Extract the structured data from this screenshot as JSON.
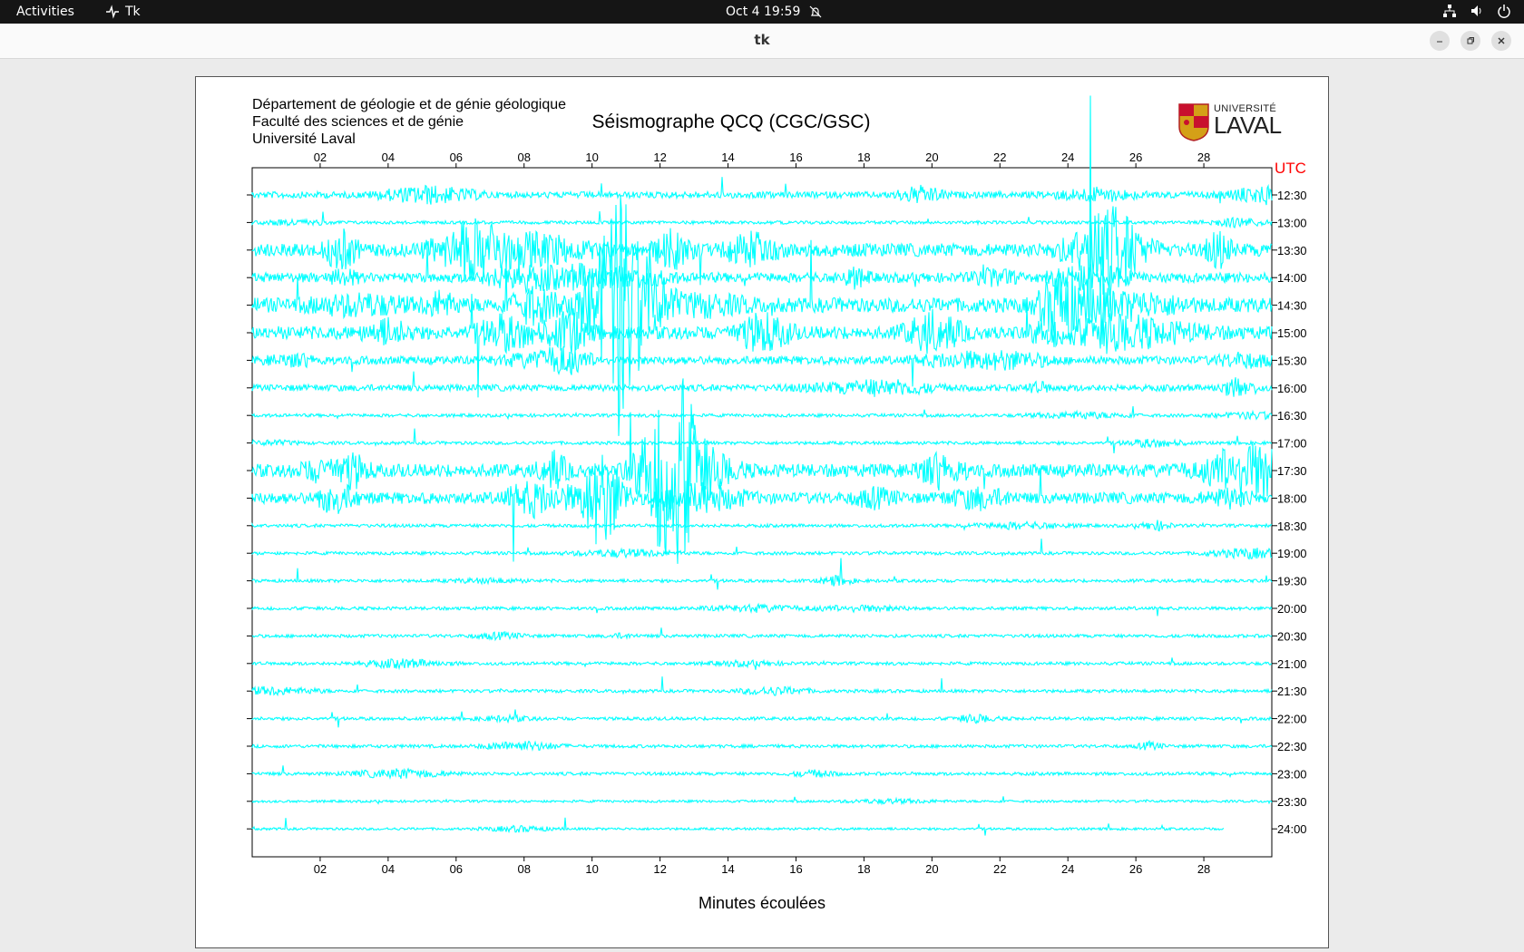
{
  "topbar": {
    "activities": "Activities",
    "app_name": "Tk",
    "clock": "Oct 4  19:59"
  },
  "window": {
    "title": "tk"
  },
  "plot": {
    "header_lines": [
      "Département de géologie et de génie géologique",
      "Faculté des sciences et de génie",
      "Université Laval"
    ],
    "title": "Séismographe QCQ (CGC/GSC)",
    "logo_top": "UNIVERSITÉ",
    "logo_main": "LAVAL",
    "utc_label": "UTC",
    "xlabel": "Minutes écoulées",
    "trace_color": "#00ffff",
    "utc_color": "#ff0000"
  },
  "chart_data": {
    "type": "line",
    "xlim": [
      0,
      30
    ],
    "x_ticks": [
      "02",
      "04",
      "06",
      "08",
      "10",
      "12",
      "14",
      "16",
      "18",
      "20",
      "22",
      "24",
      "26",
      "28"
    ],
    "row_labels": [
      "12:30",
      "13:00",
      "13:30",
      "14:00",
      "14:30",
      "15:00",
      "15:30",
      "16:00",
      "16:30",
      "17:00",
      "17:30",
      "18:00",
      "18:30",
      "19:00",
      "19:30",
      "20:00",
      "20:30",
      "21:00",
      "21:30",
      "22:00",
      "22:30",
      "23:00",
      "23:30",
      "24:00"
    ],
    "row_noise": [
      4,
      2,
      8,
      6,
      9,
      8,
      5,
      4,
      2,
      2,
      8,
      7,
      2,
      2,
      2,
      2,
      2,
      2,
      2,
      2,
      2,
      2,
      1.5,
      1.5
    ],
    "last_row_end_minute": 28.6
  }
}
